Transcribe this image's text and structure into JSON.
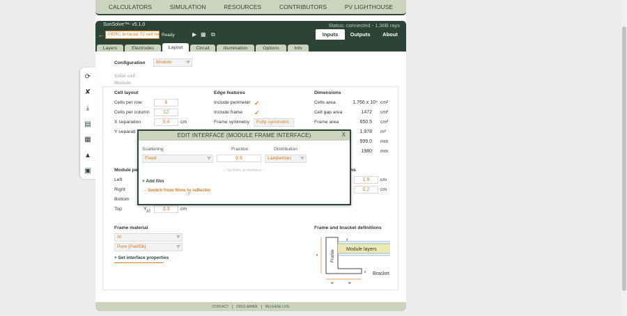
{
  "nav": [
    "CALCULATORS",
    "SIMULATION",
    "RESOURCES",
    "CONTRIBUTORS",
    "PV LIGHTHOUSE"
  ],
  "header": {
    "version": "SunSolve™- v5.1.0",
    "status": "Status: connected - 1.36B rays",
    "project": "PERC bi-facial 72 cell mo",
    "state": "Ready",
    "tabs": [
      "Inputs",
      "Outputs",
      "About"
    ]
  },
  "subtabs": [
    "Layers",
    "Electrodes",
    "Layout",
    "Circuit",
    "Illumination",
    "Options",
    "Info"
  ],
  "configuration": {
    "label": "Configuration",
    "value": "Module"
  },
  "sections": {
    "solar_cell": "Solar cell",
    "module": "Module"
  },
  "cell_layout": {
    "title": "Cell layout",
    "rows": [
      {
        "label": "Cells per row",
        "value": "6",
        "unit": ""
      },
      {
        "label": "Cells per column",
        "value": "12",
        "unit": ""
      },
      {
        "label": "X separation",
        "value": "0.4",
        "unit": "cm"
      },
      {
        "label": "Y separation",
        "value": "",
        "unit": ""
      }
    ]
  },
  "edge_features": {
    "title": "Edge features",
    "include_perimeter": "Include perimeter",
    "include_frame": "Include frame",
    "frame_symmetry": "Frame symmetry",
    "frame_symmetry_value": "Fully symmetric"
  },
  "dimensions": {
    "title": "Dimensions",
    "rows": [
      {
        "label": "Cells area",
        "value": "1.766 x 10⁴",
        "unit": "cm²"
      },
      {
        "label": "Cell gap area",
        "value": "1472",
        "unit": "cm²"
      },
      {
        "label": "Frame area",
        "value": "650.5",
        "unit": "cm²"
      },
      {
        "label": "",
        "value": "1.978",
        "unit": "m²"
      },
      {
        "label": "",
        "value": "999.0",
        "unit": "mm"
      },
      {
        "label": "",
        "value": "1980",
        "unit": "mm"
      }
    ]
  },
  "module_perimeter": {
    "title": "Module pe",
    "left": "Left",
    "right": "Right",
    "bottom": "Bottom",
    "top": "Top",
    "top_symbol": "Y",
    "top_sub": "p2",
    "top_value": "3.3",
    "top_unit": "cm",
    "right_title": "ns",
    "right_values": [
      {
        "value": "1.9",
        "unit": "cm"
      },
      {
        "value": "0.2",
        "unit": "cm"
      }
    ]
  },
  "frame_material": {
    "title": "Frame material",
    "material": "Al",
    "grade": "Pure [Pal85b]",
    "link": "+ Set interface properties"
  },
  "frame_bracket": {
    "title": "Frame and bracket definitions",
    "module_layers": "Module layers",
    "frame": "Frame",
    "bracket": "Bracket",
    "zf": "z",
    "zt": "z",
    "zb": "z",
    "wf": "w",
    "wb": "w"
  },
  "modal": {
    "title": "EDIT INTERFACE (MODULE FRAME INTERFACE)",
    "close": "X",
    "col_scattering": "Scattering",
    "col_fraction": "Fraction",
    "col_distribution": "Distribution",
    "scattering": "Fixed",
    "fraction": "0.5",
    "distribution": "Lambertian",
    "no_films": "-- No films at interface --",
    "add_film": "+ Add film",
    "switch": "→ Switch from films to reflector"
  },
  "footer": [
    "CONTACT",
    "DISCLAIMER",
    "RELEASE LOG"
  ]
}
